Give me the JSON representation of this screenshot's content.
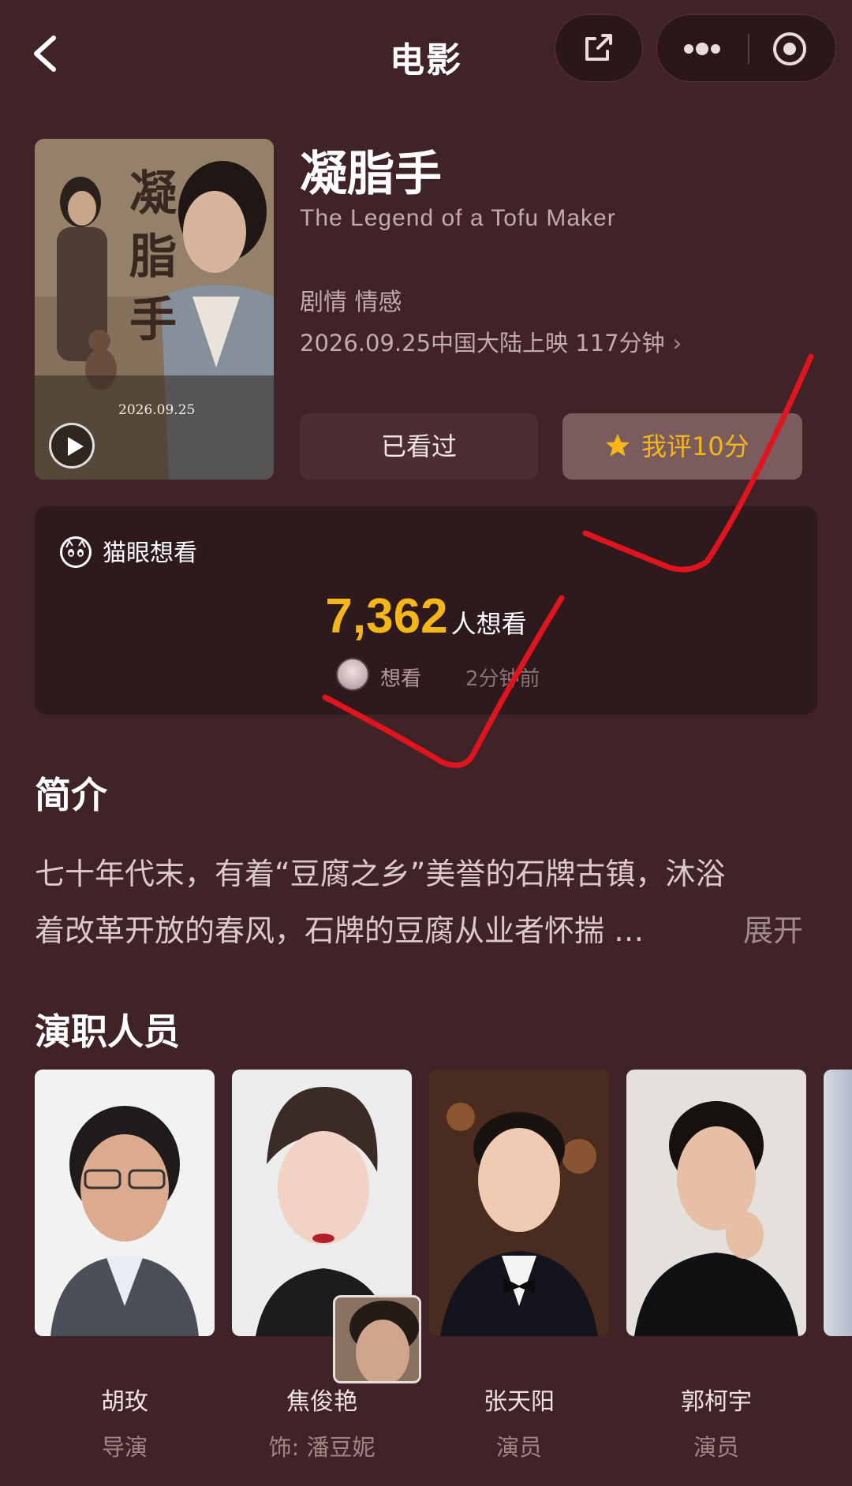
{
  "header": {
    "title": "电影"
  },
  "movie": {
    "title": "凝脂手",
    "title_en": "The Legend of a Tofu Maker",
    "genres": "剧情 情感",
    "release": "2026.09.25中国大陆上映 117分钟",
    "poster": {
      "title_text": "凝脂手",
      "date_text": "2026.09.25"
    }
  },
  "actions": {
    "seen_label": "已看过",
    "rate_label": "我评10分"
  },
  "want": {
    "source_label": "猫眼想看",
    "count": "7,362",
    "count_unit": "人想看",
    "activity_action": "想看",
    "activity_time": "2分钟前"
  },
  "synopsis": {
    "heading": "简介",
    "line1": "七十年代末，有着“豆腐之乡”美誉的石牌古镇，沐浴",
    "line2": "着改革开放的春风，石牌的豆腐从业者怀揣 …",
    "expand_label": "展开"
  },
  "cast": {
    "heading": "演职人员",
    "members": [
      {
        "name": "胡玫",
        "role": "导演"
      },
      {
        "name": "焦俊艳",
        "role": "饰: 潘豆妮"
      },
      {
        "name": "张天阳",
        "role": "演员"
      },
      {
        "name": "郭柯宇",
        "role": "演员"
      }
    ]
  },
  "colors": {
    "background": "#3f2326",
    "accent": "#f5b61a",
    "annotation": "#e0141e"
  }
}
